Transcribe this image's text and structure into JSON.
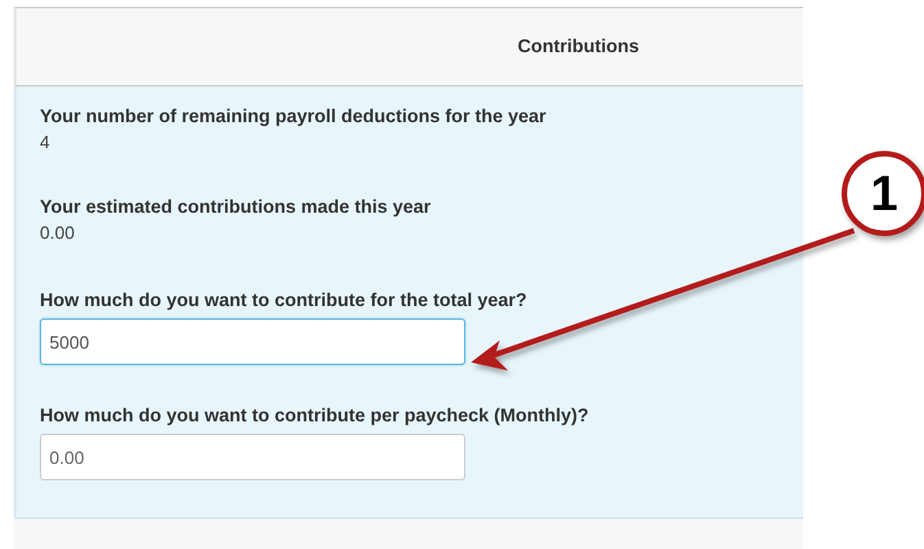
{
  "header": {
    "title": "Contributions"
  },
  "items": [
    {
      "kind": "readout",
      "label": "Your number of remaining payroll deductions for the year",
      "value": "4"
    },
    {
      "kind": "readout",
      "label": "Your estimated contributions made this year",
      "value": "0.00"
    },
    {
      "kind": "field",
      "label": "How much do you want to contribute for the total year?",
      "value": "5000",
      "focused": true
    },
    {
      "kind": "field",
      "label": "How much do you want to contribute per paycheck (Monthly)?",
      "placeholder": "0.00",
      "focused": false
    }
  ],
  "callout": {
    "number": "1"
  }
}
